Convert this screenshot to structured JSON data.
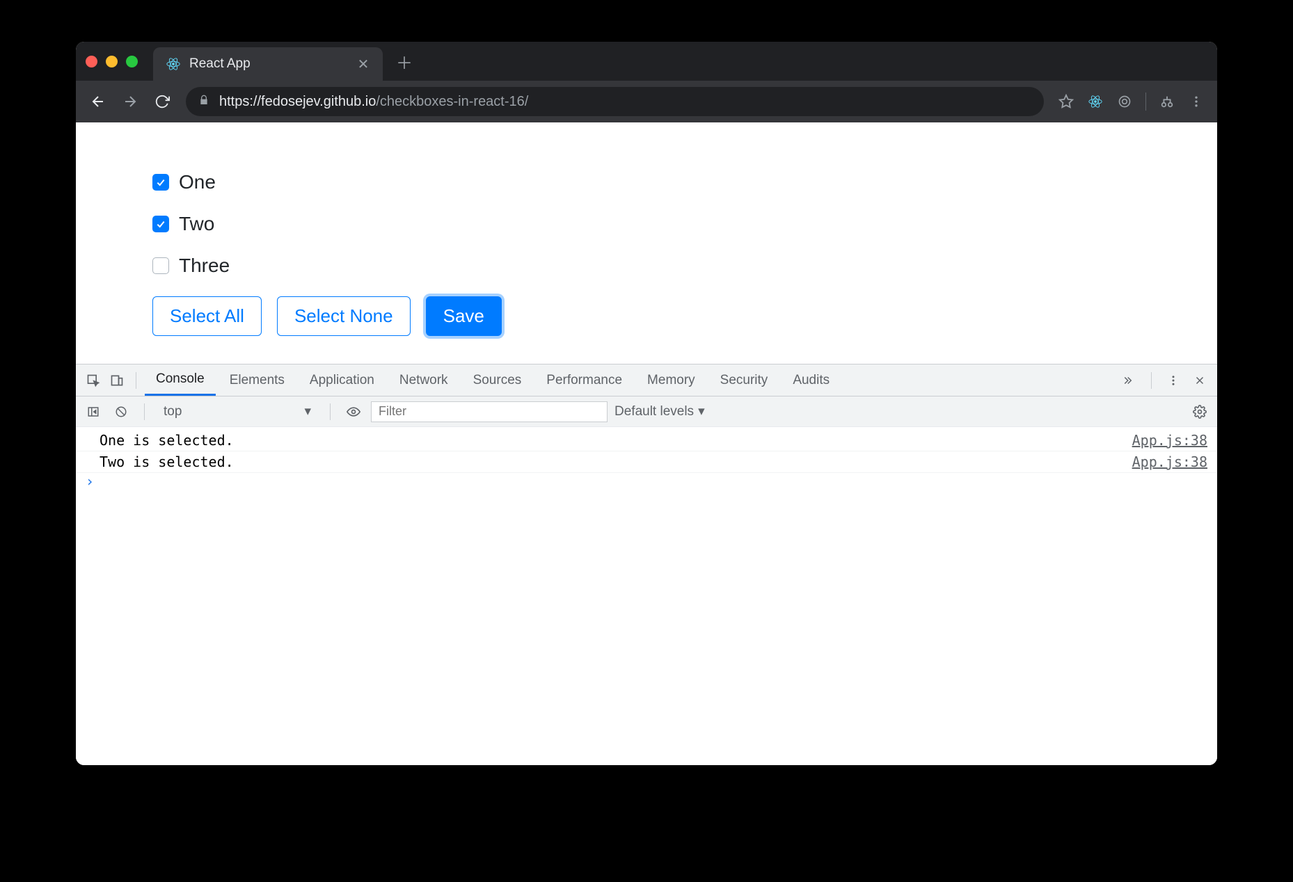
{
  "tab": {
    "title": "React App"
  },
  "addressbar": {
    "host": "https://fedosejev.github.io",
    "path": "/checkboxes-in-react-16/"
  },
  "checkboxes": [
    {
      "label": "One",
      "checked": true
    },
    {
      "label": "Two",
      "checked": true
    },
    {
      "label": "Three",
      "checked": false
    }
  ],
  "buttons": {
    "select_all": "Select All",
    "select_none": "Select None",
    "save": "Save"
  },
  "devtools": {
    "tabs": [
      "Console",
      "Elements",
      "Application",
      "Network",
      "Sources",
      "Performance",
      "Memory",
      "Security",
      "Audits"
    ],
    "active_tab": "Console",
    "context": "top",
    "filter_placeholder": "Filter",
    "levels_label": "Default levels",
    "logs": [
      {
        "message": "One is selected.",
        "source": "App.js:38"
      },
      {
        "message": "Two is selected.",
        "source": "App.js:38"
      }
    ]
  }
}
